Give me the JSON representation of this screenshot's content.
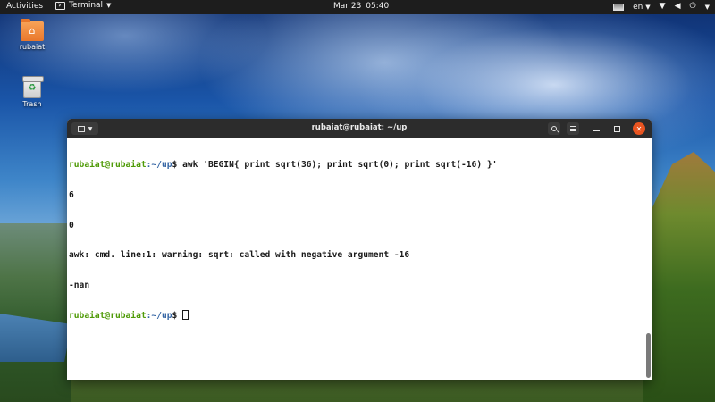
{
  "topbar": {
    "activities": "Activities",
    "app_name": "Terminal",
    "date": "Mar 23",
    "time": "05:40",
    "language": "en",
    "icons": [
      "screen-icon",
      "language-menu",
      "network-icon",
      "volume-icon",
      "power-icon"
    ]
  },
  "desktop": {
    "icons": [
      {
        "label": "rubaiat",
        "icon": "home-folder-icon"
      },
      {
        "label": "Trash",
        "icon": "trash-icon"
      }
    ]
  },
  "window": {
    "title": "rubaiat@rubaiat: ~/up",
    "buttons": [
      "new-tab",
      "search",
      "menu",
      "minimize",
      "maximize",
      "close"
    ]
  },
  "terminal": {
    "prompt_user": "rubaiat@rubaiat",
    "prompt_path": ":~/up",
    "prompt_symbol": "$ ",
    "command": "awk 'BEGIN{ print sqrt(36); print sqrt(0); print sqrt(-16) }'",
    "output": [
      "6",
      "0",
      "awk: cmd. line:1: warning: sqrt: called with negative argument -16",
      "-nan"
    ]
  },
  "colors": {
    "prompt_user": "#4e9a06",
    "prompt_path": "#3465a4",
    "close_button": "#e95420",
    "headerbar": "#2c2c2c"
  }
}
